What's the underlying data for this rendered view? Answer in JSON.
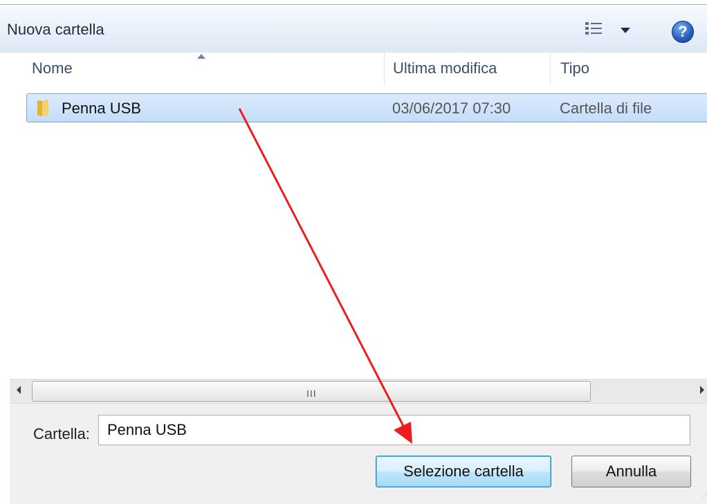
{
  "toolbar": {
    "new_folder_label": "Nuova cartella",
    "view_icon": "view-options-icon",
    "help_icon": "help-icon",
    "help_glyph": "?"
  },
  "columns": {
    "name": "Nome",
    "modified": "Ultima modifica",
    "type": "Tipo"
  },
  "rows": [
    {
      "name": "Penna USB",
      "modified": "03/06/2017 07:30",
      "type": "Cartella di file",
      "selected": true,
      "icon": "folder-icon"
    }
  ],
  "scrollbar": {
    "grip": "III"
  },
  "footer": {
    "folder_label": "Cartella:",
    "folder_value": "Penna USB",
    "select_button": "Selezione cartella",
    "cancel_button": "Annulla"
  },
  "colors": {
    "selection": "#cce4fb",
    "annotation_arrow": "#ee1c1c",
    "toolbar": "#e3ecf7"
  }
}
